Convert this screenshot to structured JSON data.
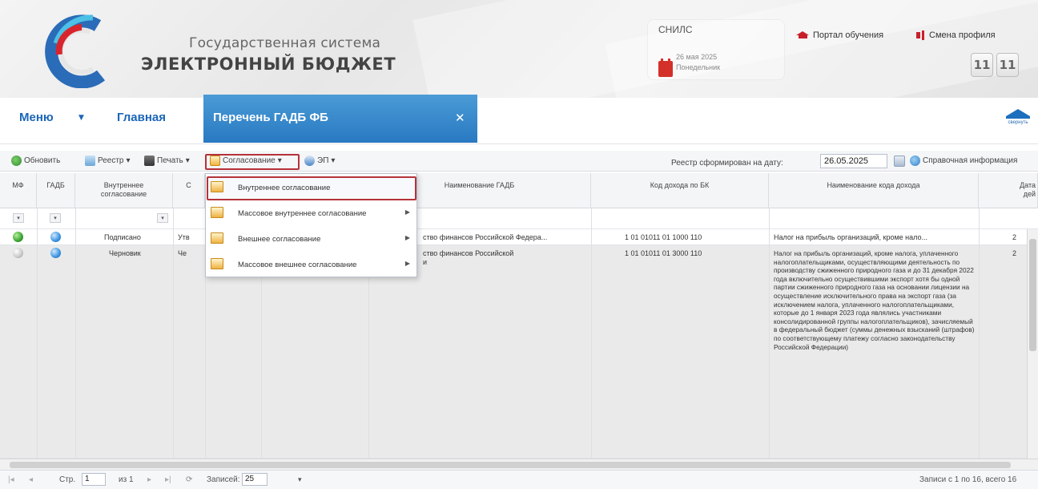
{
  "header": {
    "title_small": "Государственная система",
    "title_big": "ЭЛЕКТРОННЫЙ БЮДЖЕТ",
    "snils": "СНИЛС",
    "date_line1": "26 мая 2025",
    "date_line2": "Понедельник",
    "link_learning": "Портал обучения",
    "link_profile": "Смена профиля",
    "time_hours": "11",
    "time_minutes": "11",
    "accent_color": "#c8202a"
  },
  "nav": {
    "menu_label": "Меню",
    "home_label": "Главная",
    "active_tab_label": "Перечень ГАДБ ФБ",
    "collapse_label": "свернуть",
    "tab_color": "#2979c2"
  },
  "toolbar": {
    "refresh": "Обновить",
    "registry": "Реестр",
    "print": "Печать",
    "approval": "Согласование",
    "ep": "ЭП",
    "registry_date_label": "Реестр сформирован на дату:",
    "registry_date_value": "26.05.2025",
    "reference_info": "Справочная информация"
  },
  "dropdown": {
    "items": [
      {
        "label": "Внутреннее согласование",
        "has_submenu": false
      },
      {
        "label": "Массовое внутреннее согласование",
        "has_submenu": true
      },
      {
        "label": "Внешнее согласование",
        "has_submenu": true
      },
      {
        "label": "Массовое внешнее согласование",
        "has_submenu": true
      }
    ]
  },
  "grid": {
    "columns": [
      {
        "label": "МФ"
      },
      {
        "label": "ГАДБ"
      },
      {
        "label": "Внутреннее\nсогласование"
      },
      {
        "label": "С"
      },
      {
        "label": ""
      },
      {
        "label": ""
      },
      {
        "label": "Наименование ГАДБ"
      },
      {
        "label": "Код дохода по БК"
      },
      {
        "label": "Наименование кода дохода"
      },
      {
        "label": "Дата\nдей"
      }
    ],
    "rows": [
      {
        "internal_status": "Подписано",
        "col4": "Утв",
        "gadb_name": "ство финансов Российской Федера...",
        "code": "1 01 01011 01 1000 110",
        "code_name": "Налог на прибыль организаций, кроме нало...",
        "date": "2"
      },
      {
        "internal_status": "Черновик",
        "col4": "Че",
        "gadb_name_line1": "ство финансов Российской",
        "gadb_name_line2": "и",
        "code": "1 01 01011 01 3000 110",
        "code_name": "Налог на прибыль организаций, кроме налога, уплаченного налогоплательщиками, осуществляющими деятельность по производству сжиженного природного газа и до 31 декабря 2022 года включительно осуществившими экспорт хотя бы одной партии сжиженного природного газа на основании лицензии на осуществление исключительного права на экспорт газа (за исключением налога, уплаченного налогоплательщиками, которые до 1 января 2023 года являлись участниками консолидированной группы налогоплательщиков), зачисляемый в федеральный бюджет (суммы денежных взысканий (штрафов) по соответствующему платежу согласно законодательству Российской Федерации)",
        "date": "2"
      }
    ]
  },
  "pager": {
    "page_label": "Стр.",
    "page_value": "1",
    "of_label": "из 1",
    "records_label": "Записей:",
    "records_value": "25",
    "summary": "Записи с 1 по 16, всего 16"
  }
}
